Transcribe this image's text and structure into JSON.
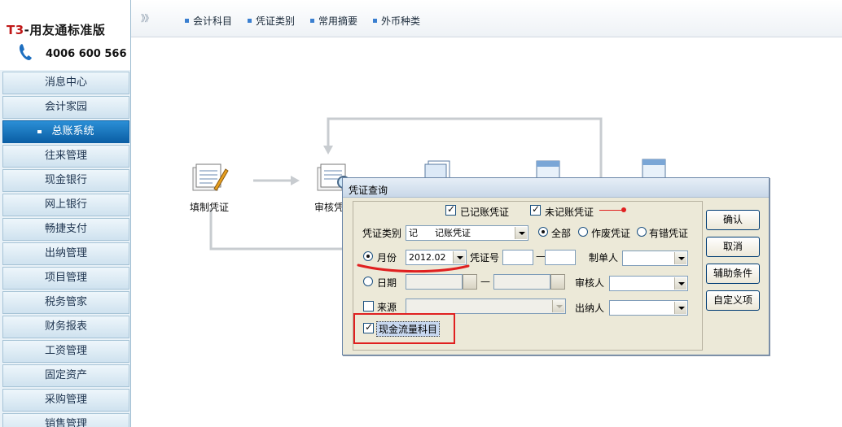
{
  "brand": {
    "title_prefix": "T3",
    "title_rest": "-用友通标准版",
    "phone": "4006 600 566"
  },
  "sidebar": {
    "items": [
      {
        "label": "消息中心"
      },
      {
        "label": "会计家园"
      },
      {
        "label": "总账系统",
        "active": true
      },
      {
        "label": "往来管理"
      },
      {
        "label": "现金银行"
      },
      {
        "label": "网上银行"
      },
      {
        "label": "畅捷支付"
      },
      {
        "label": "出纳管理"
      },
      {
        "label": "项目管理"
      },
      {
        "label": "税务管家"
      },
      {
        "label": "财务报表"
      },
      {
        "label": "工资管理"
      },
      {
        "label": "固定资产"
      },
      {
        "label": "采购管理"
      },
      {
        "label": "销售管理"
      }
    ]
  },
  "topbar": {
    "collapse_glyph": "》》",
    "links": [
      {
        "label": "会计科目"
      },
      {
        "label": "凭证类别"
      },
      {
        "label": "常用摘要"
      },
      {
        "label": "外币种类"
      }
    ]
  },
  "flow": {
    "fill_voucher_label": "填制凭证",
    "audit_voucher_label": "审核凭"
  },
  "dialog": {
    "title": "凭证查询",
    "posted_label": "已记账凭证",
    "posted_checked": true,
    "unposted_label": "未记账凭证",
    "unposted_checked": true,
    "voucher_type_label": "凭证类别",
    "voucher_type_value": "记      记账凭证",
    "scope_all_label": "全部",
    "scope_void_label": "作废凭证",
    "scope_error_label": "有错凭证",
    "scope_selected": "全部",
    "month_label": "月份",
    "month_value": "2012.02",
    "voucher_no_label": "凭证号",
    "voucher_no_from": "",
    "voucher_no_to": "",
    "range_dash": "—",
    "maker_label": "制单人",
    "maker_value": "",
    "date_label": "日期",
    "date_from": "",
    "date_to": "",
    "auditor_label": "审核人",
    "auditor_value": "",
    "source_label": "来源",
    "source_value": "",
    "cashier_label": "出纳人",
    "cashier_value": "",
    "cashflow_label": "现金流量科目",
    "cashflow_checked": true,
    "buttons": {
      "ok": "确认",
      "cancel": "取消",
      "aux": "辅助条件",
      "custom": "自定义项"
    }
  },
  "colors": {
    "accent": "#0b5fa5",
    "annotation_red": "#e02020",
    "dialog_bg": "#ece9d8"
  }
}
